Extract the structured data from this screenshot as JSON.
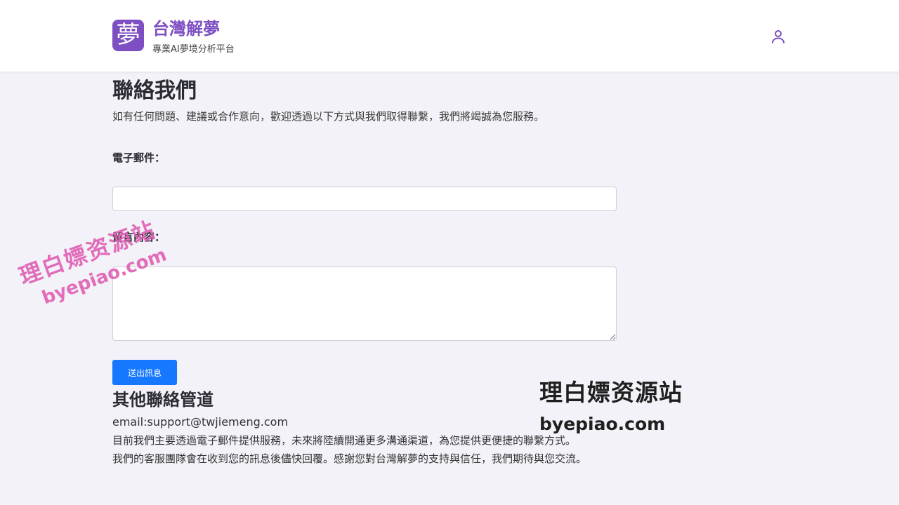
{
  "header": {
    "logo_char": "夢",
    "title": "台灣解夢",
    "subtitle": "專業AI夢境分析平台",
    "user_icon": "user-icon"
  },
  "main": {
    "title": "聯絡我們",
    "intro": "如有任何問題、建議或合作意向，歡迎透過以下方式與我們取得聯繫，我們將竭誠為您服務。",
    "form": {
      "email_label": "電子郵件：",
      "email_value": "",
      "message_label": "留言內容：",
      "message_value": "",
      "submit_label": "送出訊息"
    },
    "other": {
      "title": "其他聯絡管道",
      "email": "email:support@twjiemeng.com",
      "line1": "目前我們主要透過電子郵件提供服務，未來將陸續開通更多溝通渠道，為您提供更便捷的聯繫方式。",
      "line2": "我們的客服團隊會在收到您的訊息後儘快回覆。感謝您對台灣解夢的支持與信任，我們期待與您交流。"
    }
  },
  "watermarks": {
    "left_cn": "理白嫖资源站",
    "left_en": "byepiao.com",
    "right_cn": "理白嫖资源站",
    "right_en": "byepiao.com"
  },
  "colors": {
    "brand": "#7e4fc2",
    "button": "#1677ff",
    "background": "#f3f2f8"
  }
}
